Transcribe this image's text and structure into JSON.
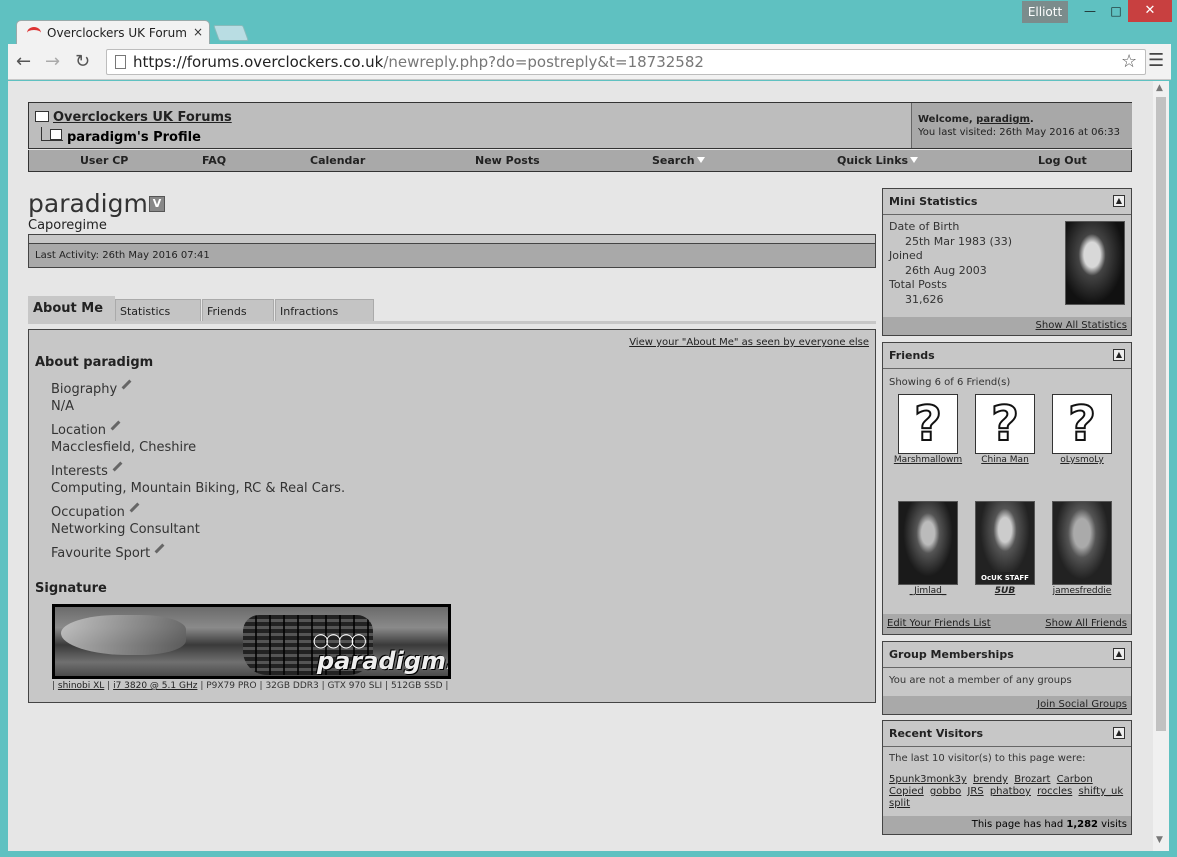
{
  "window": {
    "user": "Elliott",
    "tab_title": "Overclockers UK Forums -",
    "tab_close": "×",
    "url_host": "https://forums.overclockers.co.uk",
    "url_rest": "/newreply.php?do=postreply&t=18732582"
  },
  "header": {
    "forum_name": "Overclockers UK Forums",
    "profile_crumb": "paradigm's Profile",
    "welcome_prefix": "Welcome, ",
    "welcome_user": "paradigm",
    "welcome_suffix": ".",
    "last_visited": "You last visited: 26th May 2016 at 06:33"
  },
  "navbar": {
    "items": [
      "User CP",
      "FAQ",
      "Calendar",
      "New Posts",
      "Search",
      "Quick Links",
      "Log Out"
    ]
  },
  "profile": {
    "username": "paradigm",
    "badge": "V",
    "title": "Caporegime",
    "last_activity": "Last Activity: 26th May 2016 07:41"
  },
  "tabs": [
    "About Me",
    "Statistics",
    "Friends",
    "Infractions"
  ],
  "about": {
    "view_link": "View your \"About Me\" as seen by everyone else",
    "heading": "About paradigm",
    "fields": [
      {
        "label": "Biography",
        "value": "N/A"
      },
      {
        "label": "Location",
        "value": "Macclesfield, Cheshire"
      },
      {
        "label": "Interests",
        "value": "Computing, Mountain Biking, RC & Real Cars."
      },
      {
        "label": "Occupation",
        "value": "Networking Consultant"
      },
      {
        "label": "Favourite Sport",
        "value": ""
      }
    ],
    "signature_heading": "Signature",
    "signature_image_text": "paradigm.",
    "specs": {
      "sep": "|",
      "items": [
        "shinobi XL",
        "i7 3820 @ 5.1 GHz",
        "P9X79 PRO",
        "32GB DDR3",
        "GTX 970 SLI",
        "512GB SSD"
      ]
    }
  },
  "mini_stats": {
    "title": "Mini Statistics",
    "dob_label": "Date of Birth",
    "dob_value": "25th Mar 1983 (33)",
    "joined_label": "Joined",
    "joined_value": "26th Aug 2003",
    "posts_label": "Total Posts",
    "posts_value": "31,626",
    "footer_link": "Show All Statistics"
  },
  "friends": {
    "title": "Friends",
    "showing": "Showing 6 of 6 Friend(s)",
    "names": [
      "Marshmallowm",
      "China Man",
      "oLysmoLy",
      "_Jimlad_",
      "5UB",
      "jamesfreddie"
    ],
    "placeholder_glyph": "?",
    "staff_badge": "OcUK STAFF",
    "edit_link": "Edit Your Friends List",
    "show_all_link": "Show All Friends"
  },
  "groups": {
    "title": "Group Memberships",
    "text": "You are not a member of any groups",
    "footer_link": "Join Social Groups"
  },
  "visitors": {
    "title": "Recent Visitors",
    "intro": "The last 10 visitor(s) to this page were:",
    "names": [
      "5punk3monk3y",
      "brendy",
      "Brozart",
      "Carbon",
      "Copied",
      "gobbo",
      "JRS",
      "phatboy",
      "roccles",
      "shifty_uk",
      "split"
    ],
    "footer_prefix": "This page has had ",
    "footer_count": "1,282",
    "footer_suffix": " visits"
  }
}
